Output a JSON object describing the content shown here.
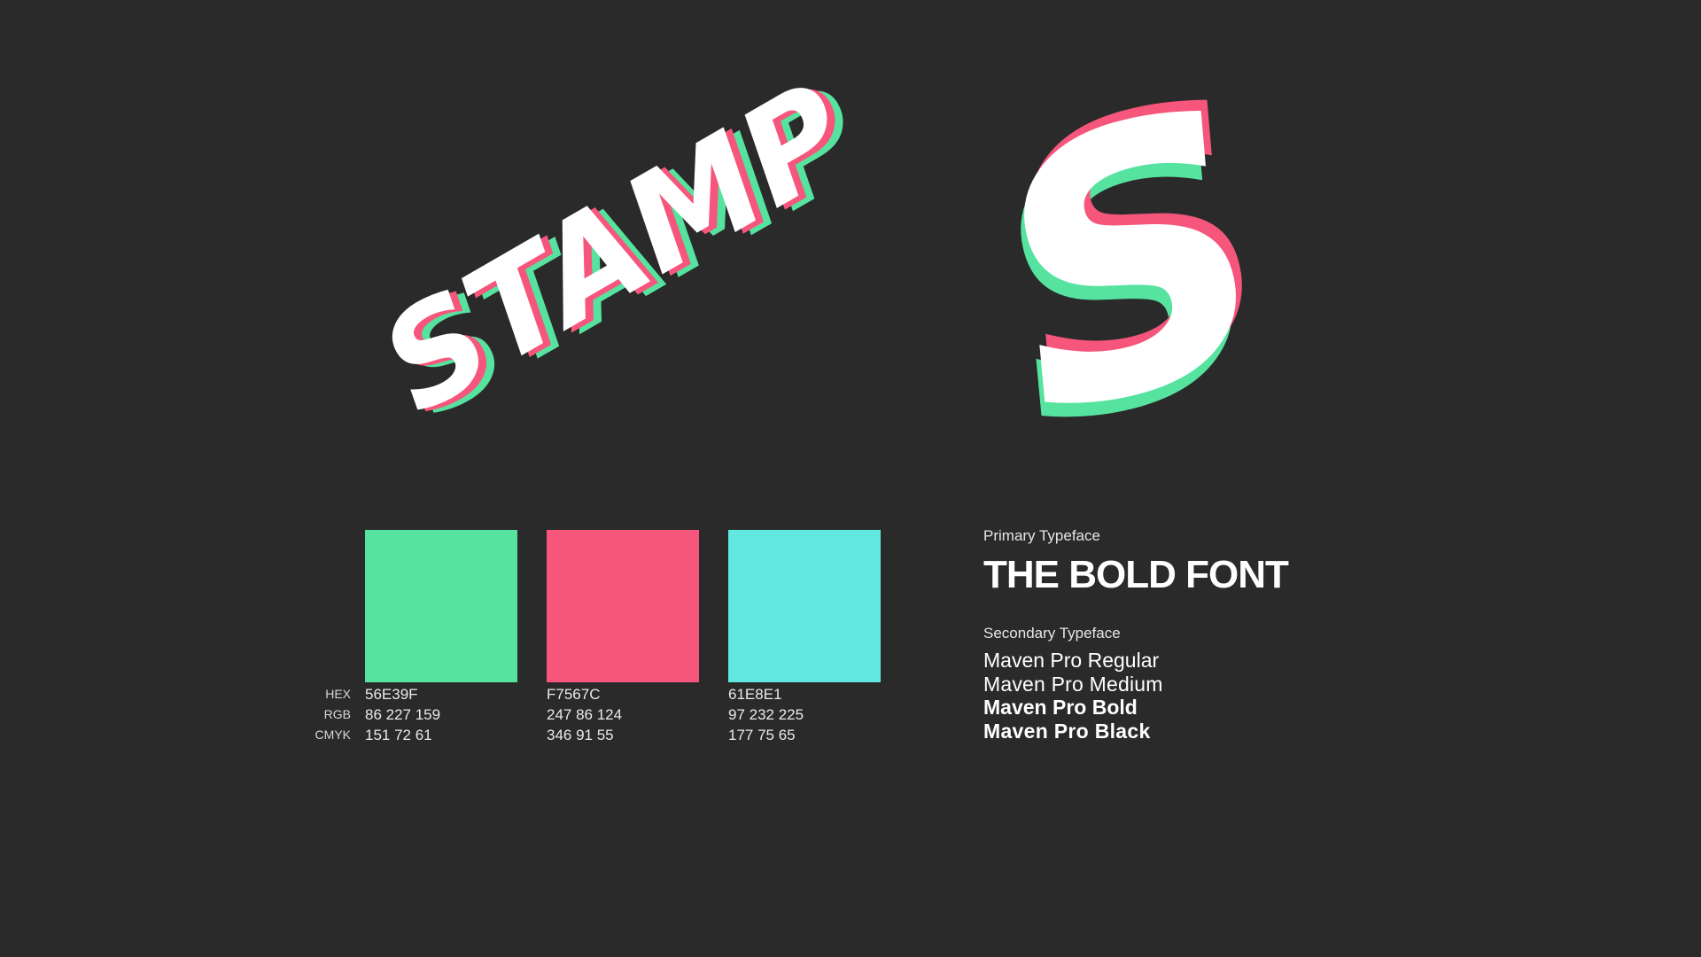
{
  "logo": {
    "wordmark": "STAMP",
    "monogram": "S",
    "colors": {
      "shadow_front": "#F7567C",
      "shadow_back": "#56E39F",
      "fill": "#FFFFFF"
    }
  },
  "palette": {
    "row_labels": [
      "HEX",
      "RGB",
      "CMYK"
    ],
    "swatches": [
      {
        "color": "#56E39F",
        "hex": "56E39F",
        "rgb": "86 227 159",
        "cmyk": "151 72 61"
      },
      {
        "color": "#F7567C",
        "hex": "F7567C",
        "rgb": "247 86 124",
        "cmyk": "346 91 55"
      },
      {
        "color": "#61E8E1",
        "hex": "61E8E1",
        "rgb": "97 232 225",
        "cmyk": "177 75 65"
      }
    ]
  },
  "typography": {
    "primary_label": "Primary Typeface",
    "primary_sample": "THE BOLD FONT",
    "secondary_label": "Secondary Typeface",
    "secondary_samples": [
      "Maven Pro Regular",
      "Maven Pro Medium",
      "Maven Pro Bold",
      "Maven Pro Black"
    ]
  }
}
